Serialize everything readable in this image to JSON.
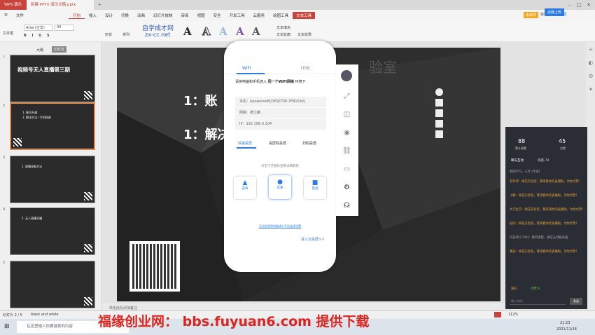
{
  "titlebar": {
    "app": "WPS 演示",
    "doc": "新建 PPTX 演示文稿.pptx",
    "add": "+"
  },
  "menu": [
    "开始",
    "插入",
    "设计",
    "切换",
    "动画",
    "幻灯片放映",
    "审阅",
    "视图",
    "安全",
    "开发工具",
    "云服务",
    "绘图工具",
    "文本工具"
  ],
  "ribbon": {
    "file": "文件",
    "font": "Arial (正文)",
    "size": "30",
    "textbox": "文本框",
    "shape": "形状",
    "arrange": "排列",
    "text_fill": "文本填充",
    "text_effect": "文本效果",
    "text_outline": "文本轮廓",
    "wordart_glyph": "A",
    "logo1": "自学成才网",
    "logo2": "zx-cc.net",
    "unsaved": "未保存",
    "collab": "协作",
    "share": "分享",
    "login": "点我上传"
  },
  "leftpanel": {
    "tab_outline": "大纲",
    "tab_slides": "幻灯片",
    "thumbs": [
      {
        "n": "1",
        "title": "视频号无人直播第三期"
      },
      {
        "n": "2",
        "line1": "1. 账号开通",
        "line2": "1. 解决方法 / 手机投屏"
      },
      {
        "n": "3",
        "line1": "1. 屏幕录制方法"
      },
      {
        "n": "4",
        "line1": "1. 无人直播开播"
      },
      {
        "n": "5",
        "line1": ""
      }
    ]
  },
  "slide": {
    "line1": "1：账",
    "line2": "1：解决",
    "bg_text": "验室"
  },
  "phone": {
    "tab_wifi": "WiFi",
    "tab_usb": "USB",
    "instruction_a": "请将电脑和手机连入 ",
    "instruction_b": "同一个WiFi网络",
    "instruction_c": " 环境下",
    "pc_label": "本机：",
    "pc_name": "Apowersoft[DESKTOP-7FB15AV]",
    "net_label": "网络：",
    "net_name": "德江麟",
    "ip_label": "IP：",
    "ip": "192.168.0.104",
    "modes": [
      "快速投屏",
      "投屏码投屏",
      "扫码投屏"
    ],
    "hint": "点击下方图标查看详细教程",
    "btn_android": "安卓",
    "btn_apple": "苹果",
    "btn_tv": "电视",
    "link1": "无法检测到电脑请与手机连接设置",
    "link2": "进入云投屏>>"
  },
  "chat": {
    "count1": "88",
    "count1_label": "累计观看",
    "count2": "45",
    "count2_label": "点赞",
    "tab1": "聊天互动",
    "tab2": "观看-78",
    "lines": [
      "新闻学习，三叶 [大家]",
      "老师哥：梅花实验室，我来看你的直播啦，为你点赞!",
      "小鹏：梅花实验室，我来看你的直播啦，为你点赞!",
      "大学生学：梅花实验室，我来看你的直播啦，为你点赞!",
      "赵四：梅花实验室，我来看你的直播啦，为你点赞!",
      "问答吧(2.5W)：看得清楚，微信支付服务器",
      "素质：梅花实验室，我来看你的直播啦，为你点赞!"
    ],
    "gift": "送礼",
    "like": "点赞 0",
    "input": "输入你的...",
    "send": "发送"
  },
  "status": {
    "slide": "幻灯片 2 / 5",
    "theme": "black and white",
    "notes": "单击此处添加备注",
    "zoom": "112%",
    "time": "21:23",
    "date": "2021/11/18"
  },
  "taskbar": {
    "search": "在这里输入你要搜索的内容"
  },
  "watermark": "福缘创业网：  bbs.fuyuan6.com   提供下载",
  "colors": {
    "accent": "#c9443a",
    "phone_blue": "#2d7be5",
    "slide": "#2e2e2e",
    "watermark": "#e0231d"
  }
}
